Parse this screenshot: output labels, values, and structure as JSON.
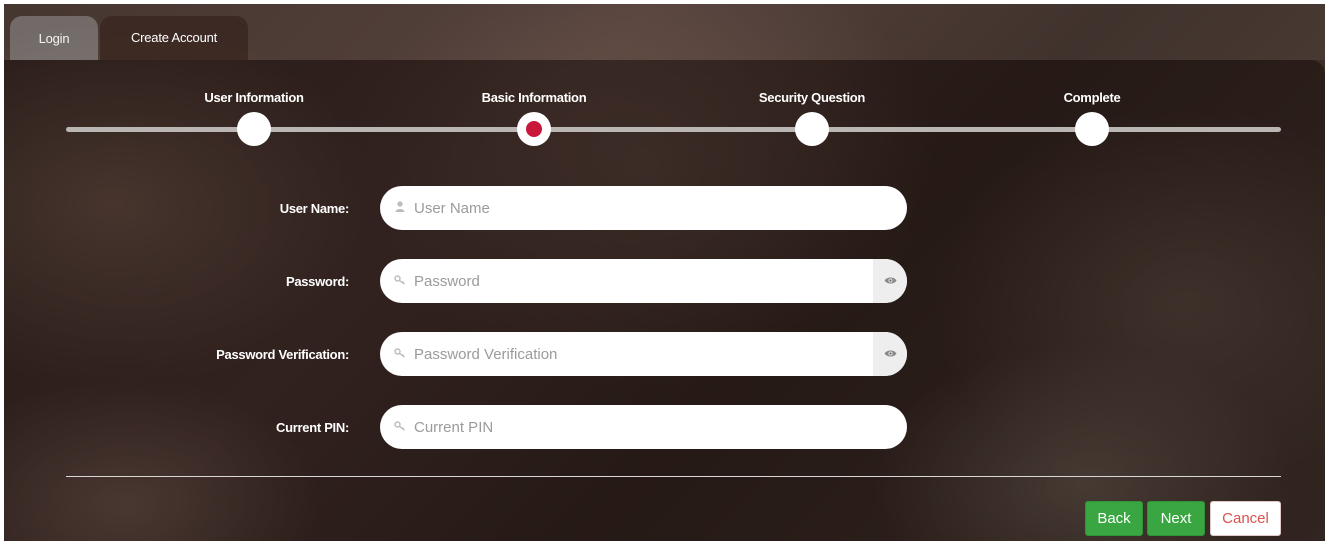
{
  "tabs": [
    {
      "label": "Login"
    },
    {
      "label": "Create Account"
    }
  ],
  "steps": [
    {
      "label": "User Information"
    },
    {
      "label": "Basic Information"
    },
    {
      "label": "Security Question"
    },
    {
      "label": "Complete"
    }
  ],
  "form": {
    "username": {
      "label": "User Name:",
      "placeholder": "User Name",
      "value": ""
    },
    "password": {
      "label": "Password:",
      "placeholder": "Password",
      "value": ""
    },
    "password_verification": {
      "label": "Password Verification:",
      "placeholder": "Password Verification",
      "value": ""
    },
    "current_pin": {
      "label": "Current PIN:",
      "placeholder": "Current PIN",
      "value": ""
    }
  },
  "buttons": {
    "back": "Back",
    "next": "Next",
    "cancel": "Cancel"
  },
  "colors": {
    "active_step": "#c8173a",
    "primary_button": "#3aa641",
    "cancel_text": "#d9534f"
  },
  "icons": {
    "username": "user-icon",
    "password": "key-icon",
    "password_verification": "key-icon",
    "current_pin": "key-icon",
    "toggle": "eye-icon"
  }
}
